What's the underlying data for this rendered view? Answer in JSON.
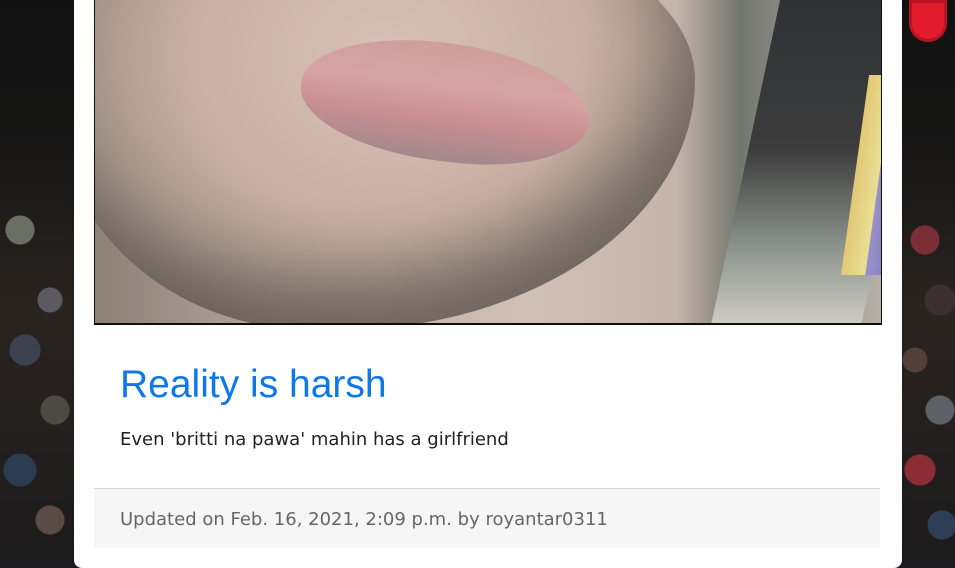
{
  "post": {
    "title": "Reality is harsh",
    "text": "Even 'britti na pawa' mahin has a girlfriend",
    "meta": "Updated on Feb. 16, 2021, 2:09 p.m. by royantar0311"
  },
  "colors": {
    "title": "#0d78ea",
    "text": "#222222",
    "meta": "#666666",
    "card_bg": "#ffffff",
    "footer_bg": "#f6f6f6"
  }
}
